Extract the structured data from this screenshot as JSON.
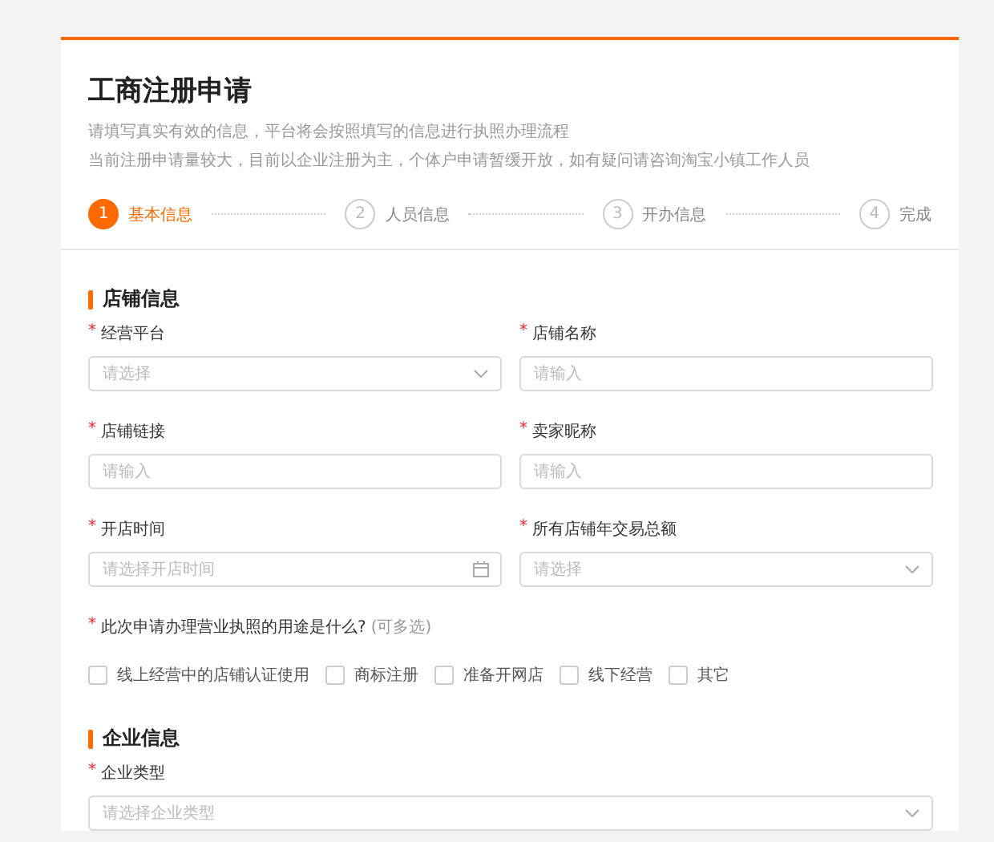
{
  "header": {
    "title": "工商注册申请",
    "notes": [
      "请填写真实有效的信息，平台将会按照填写的信息进行执照办理流程",
      "当前注册申请量较大，目前以企业注册为主，个体户申请暂缓开放，如有疑问请咨询淘宝小镇工作人员"
    ]
  },
  "steps": [
    {
      "number": "1",
      "label": "基本信息",
      "selected": true
    },
    {
      "number": "2",
      "label": "人员信息",
      "selected": false
    },
    {
      "number": "3",
      "label": "开办信息",
      "selected": false
    },
    {
      "number": "4",
      "label": "完成",
      "selected": false
    }
  ],
  "sections": [
    {
      "title": "店铺信息",
      "fields": [
        {
          "label": "经营平台",
          "mark": "*",
          "kind": "select",
          "placeholder": "请选择"
        },
        {
          "label": "店铺名称",
          "mark": "*",
          "kind": "input",
          "placeholder": "请输入"
        },
        {
          "label": "店铺链接",
          "mark": "*",
          "kind": "input",
          "placeholder": "请输入"
        },
        {
          "label": "卖家昵称",
          "mark": "*",
          "kind": "input",
          "placeholder": "请输入"
        },
        {
          "label": "开店时间",
          "mark": "*",
          "kind": "date",
          "placeholder": "请选择开店时间"
        },
        {
          "label": "所有店铺年交易总额",
          "mark": "*",
          "kind": "select",
          "placeholder": "请选择"
        }
      ],
      "question": {
        "label": "此次申请办理营业执照的用途是什么?",
        "hint": "(可多选)",
        "mark": "*",
        "options": [
          {
            "label": "线上经营中的店铺认证使用",
            "checked": false
          },
          {
            "label": "商标注册",
            "checked": false
          },
          {
            "label": "准备开网店",
            "checked": false
          },
          {
            "label": "线下经营",
            "checked": false
          },
          {
            "label": "其它",
            "checked": false
          }
        ]
      }
    },
    {
      "title": "企业信息",
      "fields": [
        {
          "label": "企业类型",
          "mark": "*",
          "kind": "select",
          "placeholder": "请选择企业类型"
        }
      ]
    }
  ]
}
